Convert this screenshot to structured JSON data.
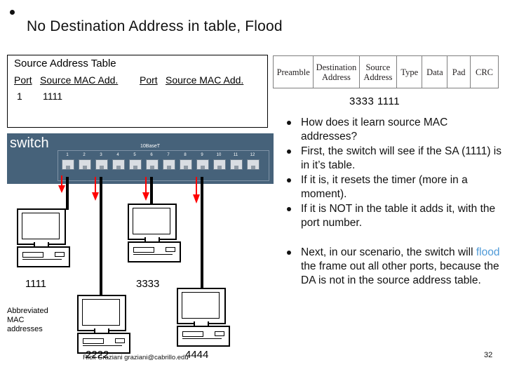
{
  "slide": {
    "title": "No Destination Address in table, Flood",
    "number": "32",
    "credit": "Rick Graziani graziani@cabrillo.edu"
  },
  "source_address_table": {
    "title": "Source Address Table",
    "headers": [
      "Port",
      "Source MAC Add.",
      "Port",
      "Source MAC Add."
    ],
    "rows": [
      {
        "port": "1",
        "mac": "1111"
      }
    ]
  },
  "frame": {
    "fields": [
      "Preamble",
      "Destination Address",
      "Source Address",
      "Type",
      "Data",
      "Pad",
      "CRC"
    ],
    "values": "3333   1111"
  },
  "switch": {
    "label": "switch",
    "interface_label": "10BaseT",
    "ports": [
      "1",
      "2",
      "3",
      "4",
      "5",
      "6",
      "7",
      "8",
      "9",
      "10",
      "11",
      "12"
    ]
  },
  "hosts": [
    {
      "mac": "1111"
    },
    {
      "mac": "3333"
    },
    {
      "mac": "2222"
    },
    {
      "mac": "4444"
    }
  ],
  "abbrev_note": "Abbreviated\nMAC\naddresses",
  "abbrev_lines": [
    "Abbreviated",
    "MAC",
    "addresses"
  ],
  "bullets": [
    "How does it learn source MAC addresses?",
    "First, the switch will see if the SA (1111) is in it’s table.",
    "If it is, it resets the timer (more in a moment).",
    "If it is NOT in the table it adds it, with the port number."
  ],
  "last_bullet": {
    "pre": "Next, in our scenario, the switch will ",
    "highlight": "flood",
    "post": " the frame out all other ports, because the DA is not in the source address table."
  },
  "colors": {
    "switch_body": "#46627a",
    "highlight": "#4f9ad7",
    "arrow": "#ff0000"
  }
}
